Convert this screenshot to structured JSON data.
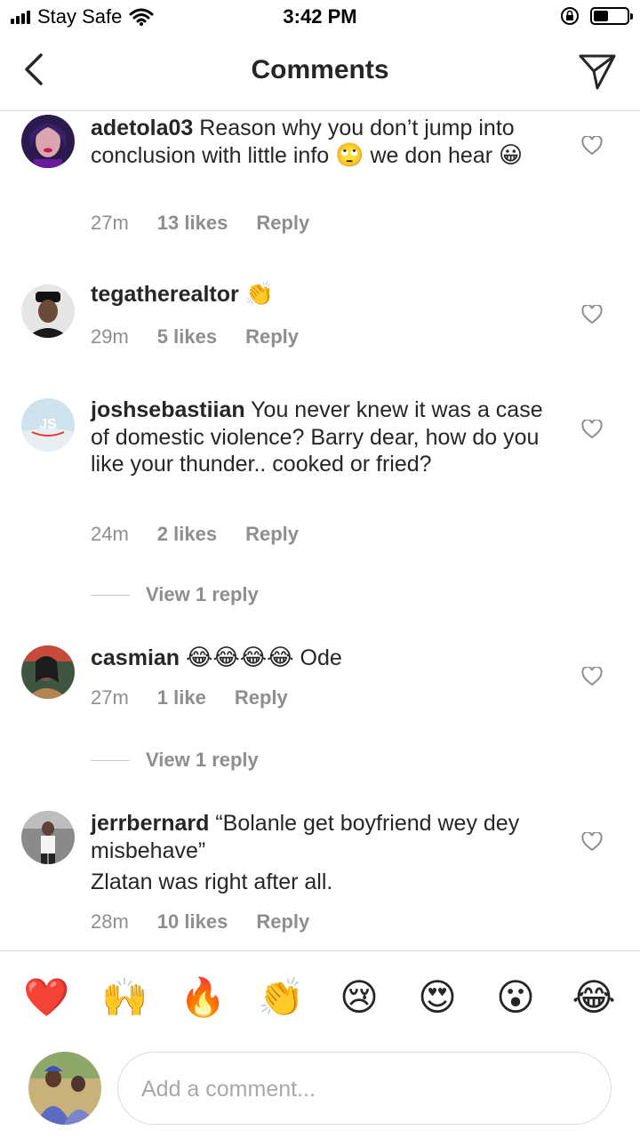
{
  "status_bar": {
    "carrier": "Stay Safe",
    "time": "3:42 PM"
  },
  "header": {
    "title": "Comments"
  },
  "comments": [
    {
      "username": "adetola03",
      "text_parts": [
        "Reason why you don’t jump into conclusion with little info ",
        "🙄",
        " we don hear ",
        "😀"
      ],
      "time": "27m",
      "likes": "13 likes",
      "reply": "Reply"
    },
    {
      "username": "tegatherealtor",
      "text_parts": [
        "👏"
      ],
      "time": "29m",
      "likes": "5 likes",
      "reply": "Reply"
    },
    {
      "username": "joshsebastiian",
      "text": "You never knew it was a case of domestic violence? Barry dear, how do you like your thunder.. cooked or fried?",
      "time": "24m",
      "likes": "2 likes",
      "reply": "Reply",
      "view_replies": "View 1 reply"
    },
    {
      "username": "casmian",
      "text_parts": [
        "😂😂😂😂",
        " Ode"
      ],
      "time": "27m",
      "likes": "1 like",
      "reply": "Reply",
      "view_replies": "View 1 reply"
    },
    {
      "username": "jerrbernard",
      "text": "“Bolanle get boyfriend wey dey misbehave”",
      "text2": "Zlatan was right after all.",
      "time": "28m",
      "likes": "10 likes",
      "reply": "Reply"
    }
  ],
  "reactions": [
    "❤️",
    "🙌",
    "🔥",
    "👏",
    "😢",
    "😍",
    "😮",
    "😂"
  ],
  "composer": {
    "placeholder": "Add a comment..."
  }
}
